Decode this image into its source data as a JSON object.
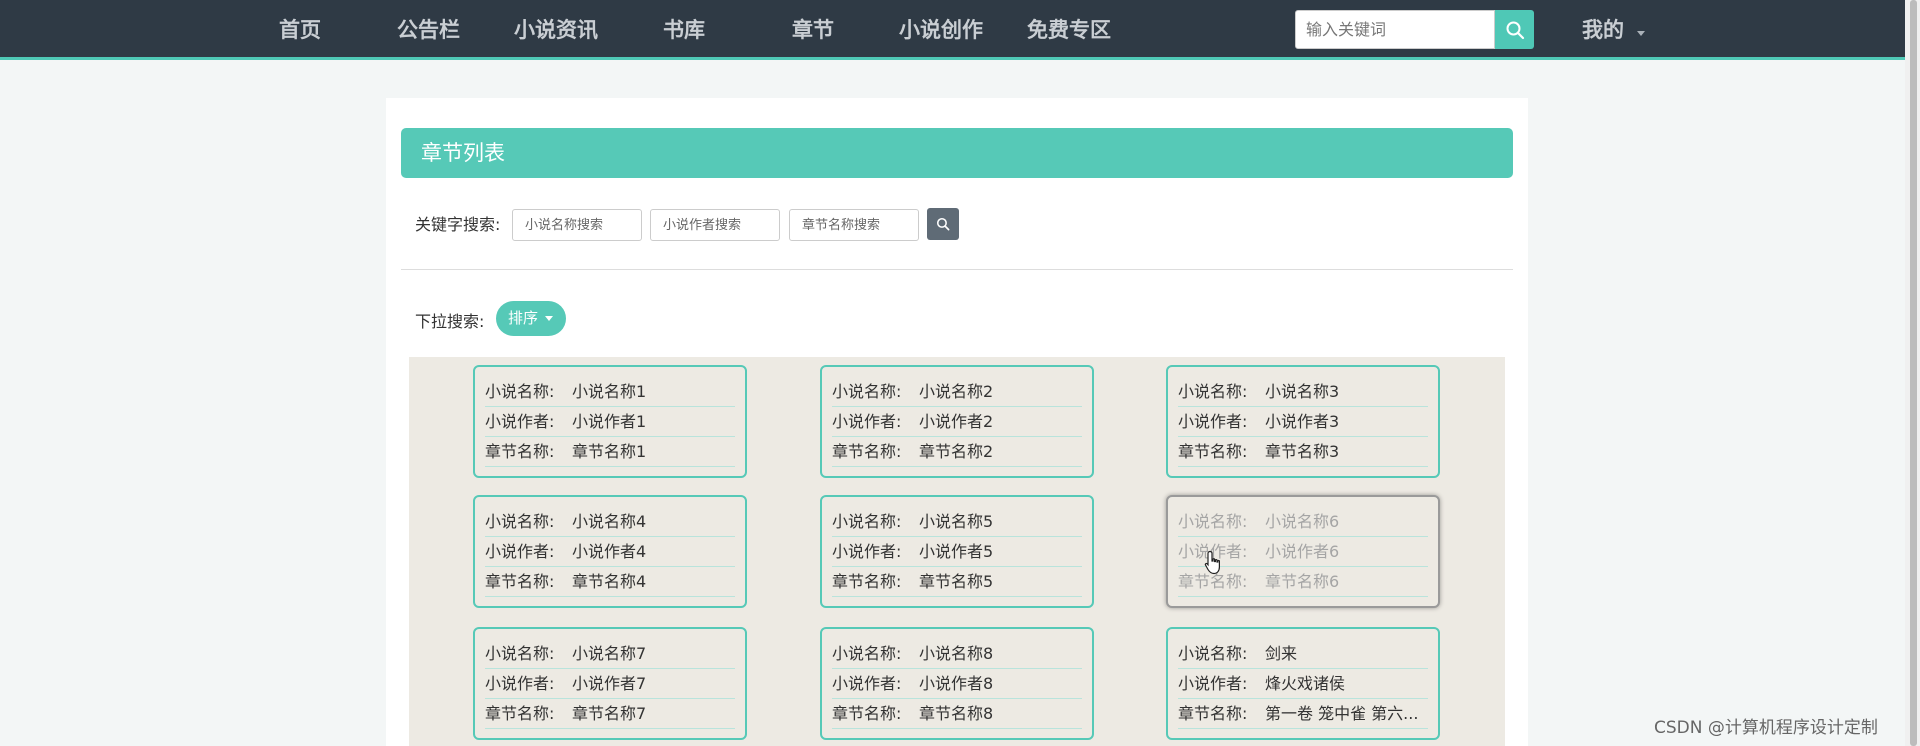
{
  "nav": {
    "items": [
      "首页",
      "公告栏",
      "小说资讯",
      "书库",
      "章节",
      "小说创作",
      "免费专区"
    ],
    "search_placeholder": "输入关键词",
    "mine": "我的"
  },
  "panel": {
    "title": "章节列表",
    "keyword_label": "关键字搜索:",
    "novel_name_placeholder": "小说名称搜索",
    "novel_author_placeholder": "小说作者搜索",
    "chapter_name_placeholder": "章节名称搜索",
    "dropdown_label": "下拉搜索:",
    "sort_label": "排序"
  },
  "card_labels": {
    "novel_name": "小说名称:",
    "novel_author": "小说作者:",
    "chapter_name": "章节名称:"
  },
  "cards": [
    {
      "novel_name": "小说名称1",
      "novel_author": "小说作者1",
      "chapter_name": "章节名称1"
    },
    {
      "novel_name": "小说名称2",
      "novel_author": "小说作者2",
      "chapter_name": "章节名称2"
    },
    {
      "novel_name": "小说名称3",
      "novel_author": "小说作者3",
      "chapter_name": "章节名称3"
    },
    {
      "novel_name": "小说名称4",
      "novel_author": "小说作者4",
      "chapter_name": "章节名称4"
    },
    {
      "novel_name": "小说名称5",
      "novel_author": "小说作者5",
      "chapter_name": "章节名称5"
    },
    {
      "novel_name": "小说名称6",
      "novel_author": "小说作者6",
      "chapter_name": "章节名称6"
    },
    {
      "novel_name": "小说名称7",
      "novel_author": "小说作者7",
      "chapter_name": "章节名称7"
    },
    {
      "novel_name": "小说名称8",
      "novel_author": "小说作者8",
      "chapter_name": "章节名称8"
    },
    {
      "novel_name": "剑来",
      "novel_author": "烽火戏诸侯",
      "chapter_name": "第一卷 笼中雀 第六..."
    }
  ],
  "watermark": "CSDN @计算机程序设计定制",
  "colors": {
    "nav_bg": "#2f3a45",
    "accent": "#56c9b7",
    "grid_bg": "#edeae3"
  },
  "icons": [
    "search-icon",
    "caret-down-icon",
    "pointer-hand-icon"
  ]
}
